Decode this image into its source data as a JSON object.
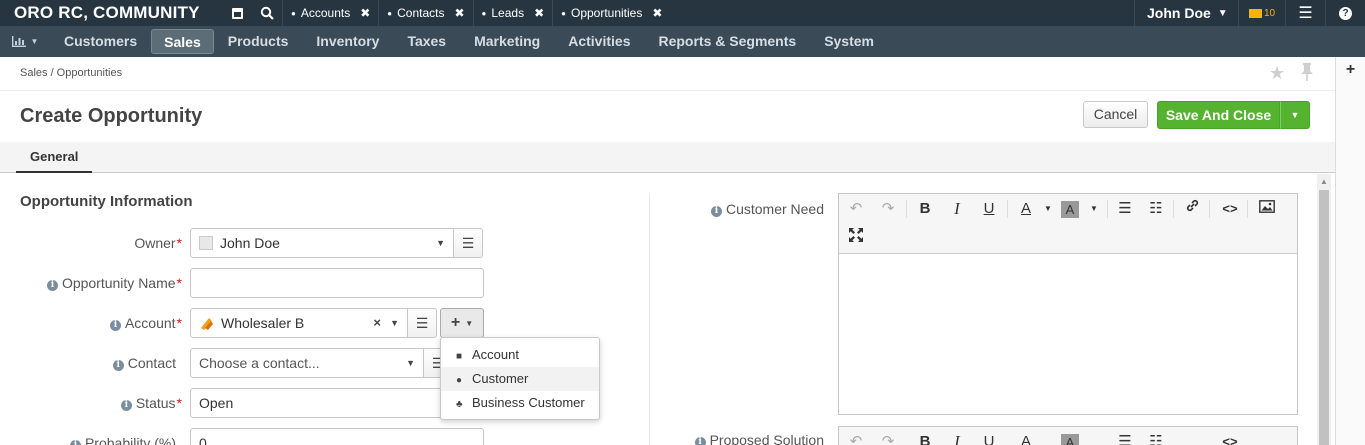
{
  "app": {
    "logo": "ORO RC, COMMUNITY"
  },
  "pinned_tabs": [
    {
      "label": "Accounts"
    },
    {
      "label": "Contacts"
    },
    {
      "label": "Leads"
    },
    {
      "label": "Opportunities"
    }
  ],
  "user": {
    "name": "John Doe",
    "mail_count": "10"
  },
  "nav": {
    "items": [
      "Customers",
      "Sales",
      "Products",
      "Inventory",
      "Taxes",
      "Marketing",
      "Activities",
      "Reports & Segments",
      "System"
    ],
    "active": "Sales"
  },
  "breadcrumb": "Sales / Opportunities",
  "page": {
    "title": "Create Opportunity"
  },
  "actions": {
    "cancel": "Cancel",
    "save": "Save And Close"
  },
  "tabs": {
    "general": "General"
  },
  "section": {
    "title": "Opportunity Information"
  },
  "form": {
    "owner": {
      "label": "Owner",
      "value": "John Doe"
    },
    "opportunity_name": {
      "label": "Opportunity Name",
      "value": ""
    },
    "account": {
      "label": "Account",
      "value": "Wholesaler B"
    },
    "contact": {
      "label": "Contact",
      "placeholder": "Choose a contact..."
    },
    "status": {
      "label": "Status",
      "value": "Open"
    },
    "probability": {
      "label": "Probability (%)",
      "value": "0"
    },
    "customer_need": {
      "label": "Customer Need"
    },
    "proposed_solution": {
      "label": "Proposed Solution"
    }
  },
  "create_menu": {
    "items": [
      {
        "label": "Account",
        "icon": "briefcase-icon"
      },
      {
        "label": "Customer",
        "icon": "user-icon"
      },
      {
        "label": "Business Customer",
        "icon": "users-icon"
      }
    ],
    "hovered": "Customer"
  },
  "colors": {
    "topbar": "#263540",
    "nav": "#3a4a57",
    "save": "#55b32f",
    "required": "#c81c1c"
  }
}
